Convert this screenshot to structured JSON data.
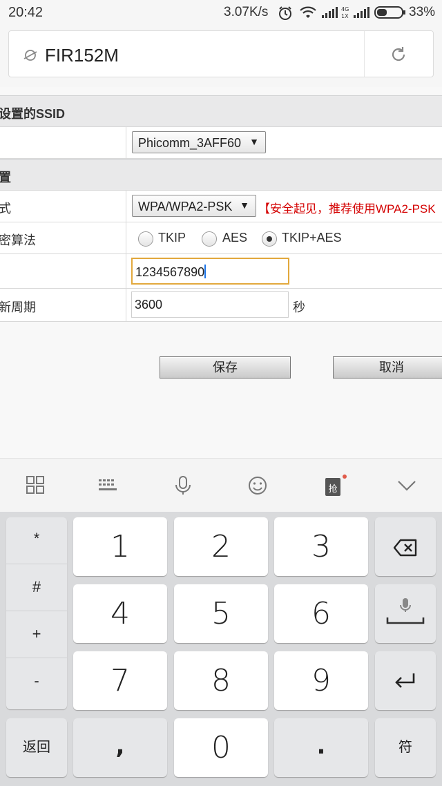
{
  "status_bar": {
    "time": "20:42",
    "speed": "3.07K/s",
    "battery": "33%"
  },
  "browser": {
    "url": "FIR152M"
  },
  "page": {
    "ssid_section": "设置的SSID",
    "ssid_select": "Phicomm_3AFF60",
    "security_section": "置",
    "mode_label": "式",
    "mode_select": "WPA/WPA2-PSK",
    "mode_warning": "【安全起见，推荐使用WPA2-PSK",
    "cipher_label": "密算法",
    "cipher_options": [
      "TKIP",
      "AES",
      "TKIP+AES"
    ],
    "cipher_selected": "TKIP+AES",
    "password_value": "1234567890",
    "renew_label": "新周期",
    "renew_value": "3600",
    "renew_unit": "秒",
    "save_label": "保存",
    "cancel_label": "取消"
  },
  "keyboard": {
    "toolbar_icons": [
      "grid-menu-icon",
      "keyboard-icon",
      "microphone-icon",
      "emoji-icon",
      "grab-ticket-icon",
      "collapse-keyboard-icon"
    ],
    "toolbar_badge_glyph": "抢",
    "symbols": [
      "*",
      "#",
      "+",
      "-"
    ],
    "digits": [
      "1",
      "2",
      "3",
      "4",
      "5",
      "6",
      "7",
      "8",
      "9"
    ],
    "back_label": "返回",
    "comma": ",",
    "zero": "0",
    "dot": ".",
    "symbol_label": "符"
  },
  "colors": {
    "warning": "#d40000",
    "focus_border": "#e2a83c",
    "cursor": "#1a73e8"
  }
}
